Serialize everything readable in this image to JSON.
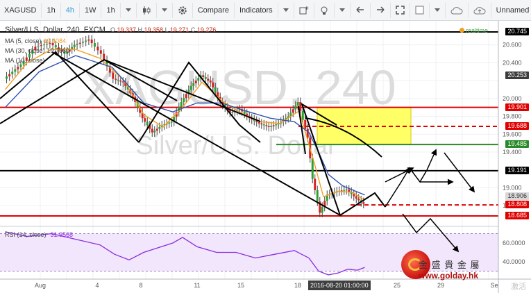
{
  "toolbar": {
    "symbol": "XAGUSD",
    "intervals": [
      "1h",
      "4h",
      "1W",
      "1h"
    ],
    "active_interval": 1,
    "compare": "Compare",
    "indicators": "Indicators",
    "layout_name": "Unnamed"
  },
  "header": {
    "title": "Silver/U.S. Dollar, 240, FXCM",
    "ohlc": [
      "O",
      "19.337",
      "H",
      "19.358",
      "L",
      "19.271",
      "C",
      "19.276"
    ],
    "realtime": "realtime",
    "watermark_symbol": "XAGUSD, 240",
    "watermark_name": "Silver/U.S. Dollar"
  },
  "indicator_legends": [
    {
      "name": "MA (5, close)",
      "value": "19.4084",
      "color": "#f0a020"
    },
    {
      "name": "MA (30, close)",
      "value": "19.7060",
      "color": "#3060c0"
    },
    {
      "name": "MA (10, close)",
      "value": "",
      "color": "#e05030"
    }
  ],
  "rsi": {
    "label": "RSI (14, close)",
    "value": "31.9568",
    "color": "#8a2be2",
    "overbought": 70,
    "oversold": 30,
    "ticks": [
      "60.0000",
      "40.0000"
    ]
  },
  "crosshair_time": "2016-08-20 01:00:00",
  "time_axis": [
    "Aug",
    "4",
    "8",
    "11",
    "15",
    "18",
    "25",
    "29",
    "Se"
  ],
  "price_ticks": [
    "20.600",
    "20.400",
    "20.000",
    "19.800",
    "19.600",
    "19.400",
    "19.000",
    "18.800"
  ],
  "price_labels": [
    {
      "text": "20.745",
      "kind": "black"
    },
    {
      "text": "20.253",
      "kind": "gray"
    },
    {
      "text": "19.901",
      "kind": "red"
    },
    {
      "text": "19.688",
      "kind": "red"
    },
    {
      "text": "19.485",
      "kind": "green"
    },
    {
      "text": "19.191",
      "kind": "black"
    },
    {
      "text": "18.906",
      "kind": "lightgray"
    },
    {
      "text": "18.808",
      "kind": "red"
    },
    {
      "text": "18.685",
      "kind": "red"
    }
  ],
  "brand": {
    "chinese": "金 盛 貴 金 屬",
    "url": "www.golday.hk"
  },
  "corner_text": "激活",
  "chart_data": {
    "type": "line",
    "title": "Silver/U.S. Dollar, 240, FXCM",
    "y_range": [
      18.6,
      20.8
    ],
    "series": [
      {
        "name": "XAGUSD",
        "points": [
          [
            1,
            20.22
          ],
          [
            8,
            20.38
          ],
          [
            14,
            20.58
          ],
          [
            20,
            20.62
          ],
          [
            26,
            20.5
          ],
          [
            30,
            20.6
          ],
          [
            36,
            20.66
          ],
          [
            41,
            20.5
          ],
          [
            46,
            20.22
          ],
          [
            50,
            20.18
          ],
          [
            54,
            20.02
          ],
          [
            58,
            19.78
          ],
          [
            62,
            19.62
          ],
          [
            66,
            19.7
          ],
          [
            70,
            19.74
          ],
          [
            74,
            19.96
          ],
          [
            78,
            20.14
          ],
          [
            82,
            20.26
          ],
          [
            86,
            20.18
          ],
          [
            90,
            19.96
          ],
          [
            94,
            19.84
          ],
          [
            98,
            19.88
          ],
          [
            102,
            19.78
          ],
          [
            106,
            19.72
          ],
          [
            110,
            19.68
          ],
          [
            114,
            19.72
          ],
          [
            118,
            19.8
          ],
          [
            122,
            19.96
          ],
          [
            126,
            19.56
          ],
          [
            128,
            19.1
          ],
          [
            131,
            18.72
          ],
          [
            134,
            18.92
          ],
          [
            138,
            18.96
          ],
          [
            142,
            18.98
          ],
          [
            146,
            18.88
          ],
          [
            149,
            18.82
          ]
        ]
      },
      {
        "name": "MA (5, close)",
        "points": [
          [
            1,
            20.1
          ],
          [
            10,
            20.4
          ],
          [
            20,
            20.55
          ],
          [
            30,
            20.55
          ],
          [
            40,
            20.45
          ],
          [
            50,
            20.2
          ],
          [
            58,
            19.82
          ],
          [
            66,
            19.68
          ],
          [
            74,
            19.9
          ],
          [
            82,
            20.18
          ],
          [
            90,
            19.98
          ],
          [
            98,
            19.84
          ],
          [
            106,
            19.74
          ],
          [
            114,
            19.72
          ],
          [
            122,
            19.86
          ],
          [
            128,
            19.3
          ],
          [
            132,
            18.9
          ],
          [
            138,
            18.96
          ],
          [
            144,
            18.95
          ],
          [
            149,
            18.86
          ]
        ]
      },
      {
        "name": "MA (30, close)",
        "points": [
          [
            1,
            19.9
          ],
          [
            15,
            20.3
          ],
          [
            30,
            20.48
          ],
          [
            45,
            20.35
          ],
          [
            58,
            19.95
          ],
          [
            70,
            19.85
          ],
          [
            80,
            19.95
          ],
          [
            90,
            19.95
          ],
          [
            100,
            19.86
          ],
          [
            110,
            19.78
          ],
          [
            120,
            19.74
          ],
          [
            126,
            19.62
          ],
          [
            130,
            19.4
          ],
          [
            134,
            19.15
          ],
          [
            140,
            19.02
          ],
          [
            149,
            18.92
          ]
        ]
      }
    ],
    "rsi_series": [
      [
        1,
        72
      ],
      [
        10,
        67
      ],
      [
        20,
        70
      ],
      [
        30,
        64
      ],
      [
        40,
        58
      ],
      [
        46,
        48
      ],
      [
        52,
        42
      ],
      [
        58,
        50
      ],
      [
        64,
        55
      ],
      [
        70,
        60
      ],
      [
        74,
        66
      ],
      [
        80,
        56
      ],
      [
        88,
        50
      ],
      [
        96,
        50
      ],
      [
        104,
        44
      ],
      [
        112,
        48
      ],
      [
        120,
        52
      ],
      [
        126,
        44
      ],
      [
        130,
        30
      ],
      [
        134,
        26
      ],
      [
        138,
        28
      ],
      [
        142,
        32
      ],
      [
        146,
        31
      ],
      [
        149,
        34
      ]
    ],
    "levels": [
      {
        "value": 20.745,
        "color": "#000000",
        "style": "solid"
      },
      {
        "value": 19.901,
        "color": "#e00000",
        "style": "solid"
      },
      {
        "value": 19.688,
        "color": "#e00000",
        "style": "dashed"
      },
      {
        "value": 19.485,
        "color": "#2a8a2a",
        "style": "solid"
      },
      {
        "value": 19.191,
        "color": "#000000",
        "style": "solid"
      },
      {
        "value": 18.808,
        "color": "#e00000",
        "style": "dashed"
      },
      {
        "value": 18.685,
        "color": "#e00000",
        "style": "solid"
      }
    ],
    "zone": {
      "from": 19.485,
      "to": 19.901,
      "color": "#ffff66"
    }
  }
}
